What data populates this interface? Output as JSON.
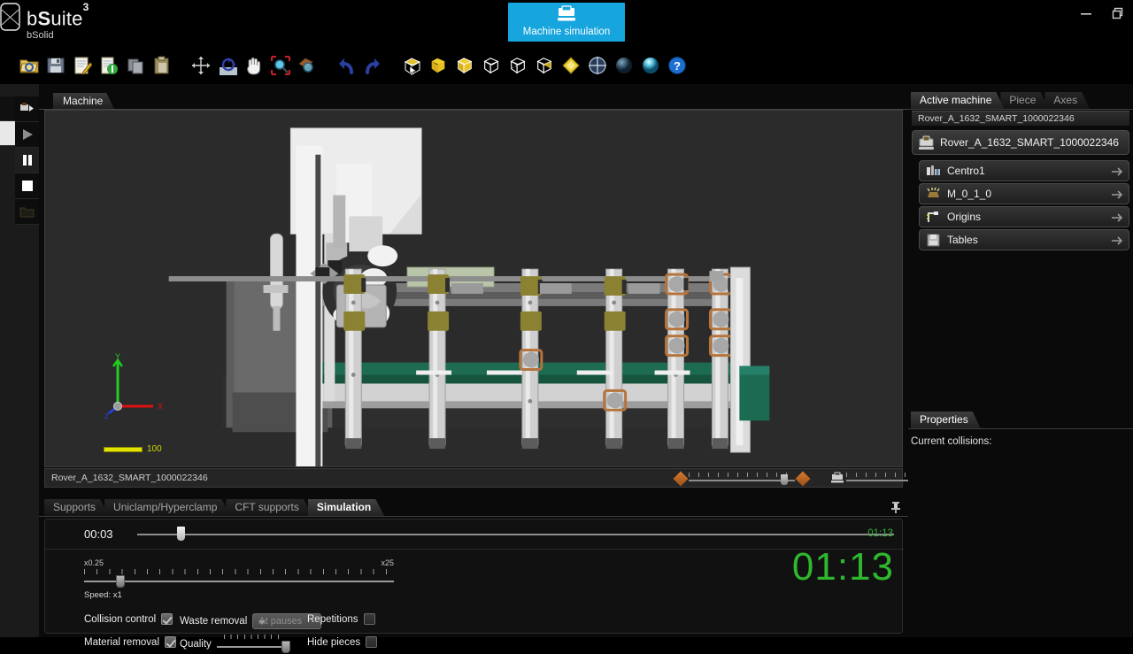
{
  "app": {
    "brand_main_prefix": "b",
    "brand_main_bold": "S",
    "brand_main_rest": "uite",
    "brand_sup": "3",
    "brand_sub": "bSolid",
    "logo_icon": "bsolid-logo-icon"
  },
  "titlebar": {
    "machine_sim_tab": {
      "label": "Machine simulation",
      "icon": "machine-icon",
      "color": "#17a5dd"
    },
    "minimize_icon": "minimize-icon",
    "restore_icon": "restore-icon"
  },
  "toolbar": {
    "items": [
      {
        "name": "open-icon",
        "title": "Open"
      },
      {
        "name": "save-icon",
        "title": "Save"
      },
      {
        "name": "edit-icon",
        "title": "Edit"
      },
      {
        "name": "refresh-document-icon",
        "title": "Reload"
      },
      {
        "name": "copy-icon",
        "title": "Copy"
      },
      {
        "name": "paste-icon",
        "title": "Paste"
      },
      {
        "name": "move-icon",
        "title": "Move"
      },
      {
        "name": "rotate-view-icon",
        "title": "Rotate view"
      },
      {
        "name": "pan-hand-icon",
        "title": "Pan"
      },
      {
        "name": "zoom-window-icon",
        "title": "Zoom window"
      },
      {
        "name": "zoom-object-icon",
        "title": "Zoom object"
      },
      {
        "name": "undo-icon",
        "title": "Undo"
      },
      {
        "name": "redo-icon",
        "title": "Redo"
      },
      {
        "name": "view-cube-select-icon",
        "title": "Select view"
      },
      {
        "name": "view-shaded-icon",
        "title": "Shaded"
      },
      {
        "name": "view-shaded-edges-icon",
        "title": "Shaded with edges"
      },
      {
        "name": "view-wireframe-icon",
        "title": "Wireframe"
      },
      {
        "name": "view-hidden-line-icon",
        "title": "Hidden line"
      },
      {
        "name": "view-transparent-icon",
        "title": "Transparent"
      },
      {
        "name": "diamond-icon",
        "title": "Highlight"
      },
      {
        "name": "target-icon",
        "title": "Center"
      },
      {
        "name": "sphere-dark-icon",
        "title": "Material dark"
      },
      {
        "name": "sphere-light-icon",
        "title": "Material light"
      },
      {
        "name": "help-icon",
        "title": "Help"
      }
    ]
  },
  "left_strip": {
    "buttons": [
      {
        "name": "step-forward-button",
        "icon": "machine-step-icon",
        "selected": false
      },
      {
        "name": "play-button",
        "icon": "play-icon",
        "selected": false
      },
      {
        "name": "pause-button",
        "icon": "pause-icon",
        "selected": true
      },
      {
        "name": "stop-button",
        "icon": "stop-icon",
        "selected": false
      },
      {
        "name": "open-folder-button",
        "icon": "folder-icon",
        "selected": false
      }
    ]
  },
  "view": {
    "tab_label": "Machine",
    "status_label": "Rover_A_1632_SMART_1000022346",
    "axis_gizmo": {
      "x": "X",
      "y": "Y",
      "z": "Z"
    },
    "scale_value": "100",
    "slider_left_icon": "diamond-icon",
    "slider_right_icon": "machine-icon"
  },
  "right_panel": {
    "tabs": [
      {
        "label": "Active machine",
        "active": true
      },
      {
        "label": "Piece",
        "active": false
      },
      {
        "label": "Axes",
        "active": false
      }
    ],
    "header": "Rover_A_1632_SMART_1000022346",
    "root_item": {
      "label": "Rover_A_1632_SMART_1000022346",
      "icon": "machine-icon"
    },
    "items": [
      {
        "label": "Centro1",
        "icon": "workcenter-icon",
        "arrow": "arrow-right-icon"
      },
      {
        "label": "M_0_1_0",
        "icon": "tool-head-icon",
        "arrow": "arrow-right-icon"
      },
      {
        "label": "Origins",
        "icon": "origin-icon",
        "arrow": "arrow-right-icon"
      },
      {
        "label": "Tables",
        "icon": "table-icon",
        "arrow": "arrow-right-icon"
      }
    ],
    "properties": {
      "tab_label": "Properties",
      "current_collisions_label": "Current collisions:"
    }
  },
  "bottom_panel": {
    "tabs": [
      {
        "label": "Supports",
        "active": false
      },
      {
        "label": "Uniclamp/Hyperclamp",
        "active": false
      },
      {
        "label": "CFT supports",
        "active": false
      },
      {
        "label": "Simulation",
        "active": true
      }
    ],
    "pin_icon": "pin-icon",
    "timeline": {
      "current": "00:03",
      "total": "01:13",
      "progress_percent": 5
    },
    "speed": {
      "min_label": "x0.25",
      "max_label": "x25",
      "caption": "Speed: x1",
      "knob_percent": 12
    },
    "options": {
      "collision_control": {
        "label": "Collision control",
        "checked": true
      },
      "material_removal": {
        "label": "Material removal",
        "checked": true
      },
      "waste_removal": {
        "label": "Waste removal",
        "value": "At pauses",
        "disabled": true
      },
      "quality": {
        "label": "Quality",
        "knob_percent": 100
      },
      "repetitions": {
        "label": "Repetitions",
        "checked": false
      },
      "hide_pieces": {
        "label": "Hide pieces",
        "checked": false
      }
    },
    "big_timer": "01:13",
    "big_timer_color": "#2eb82e"
  }
}
